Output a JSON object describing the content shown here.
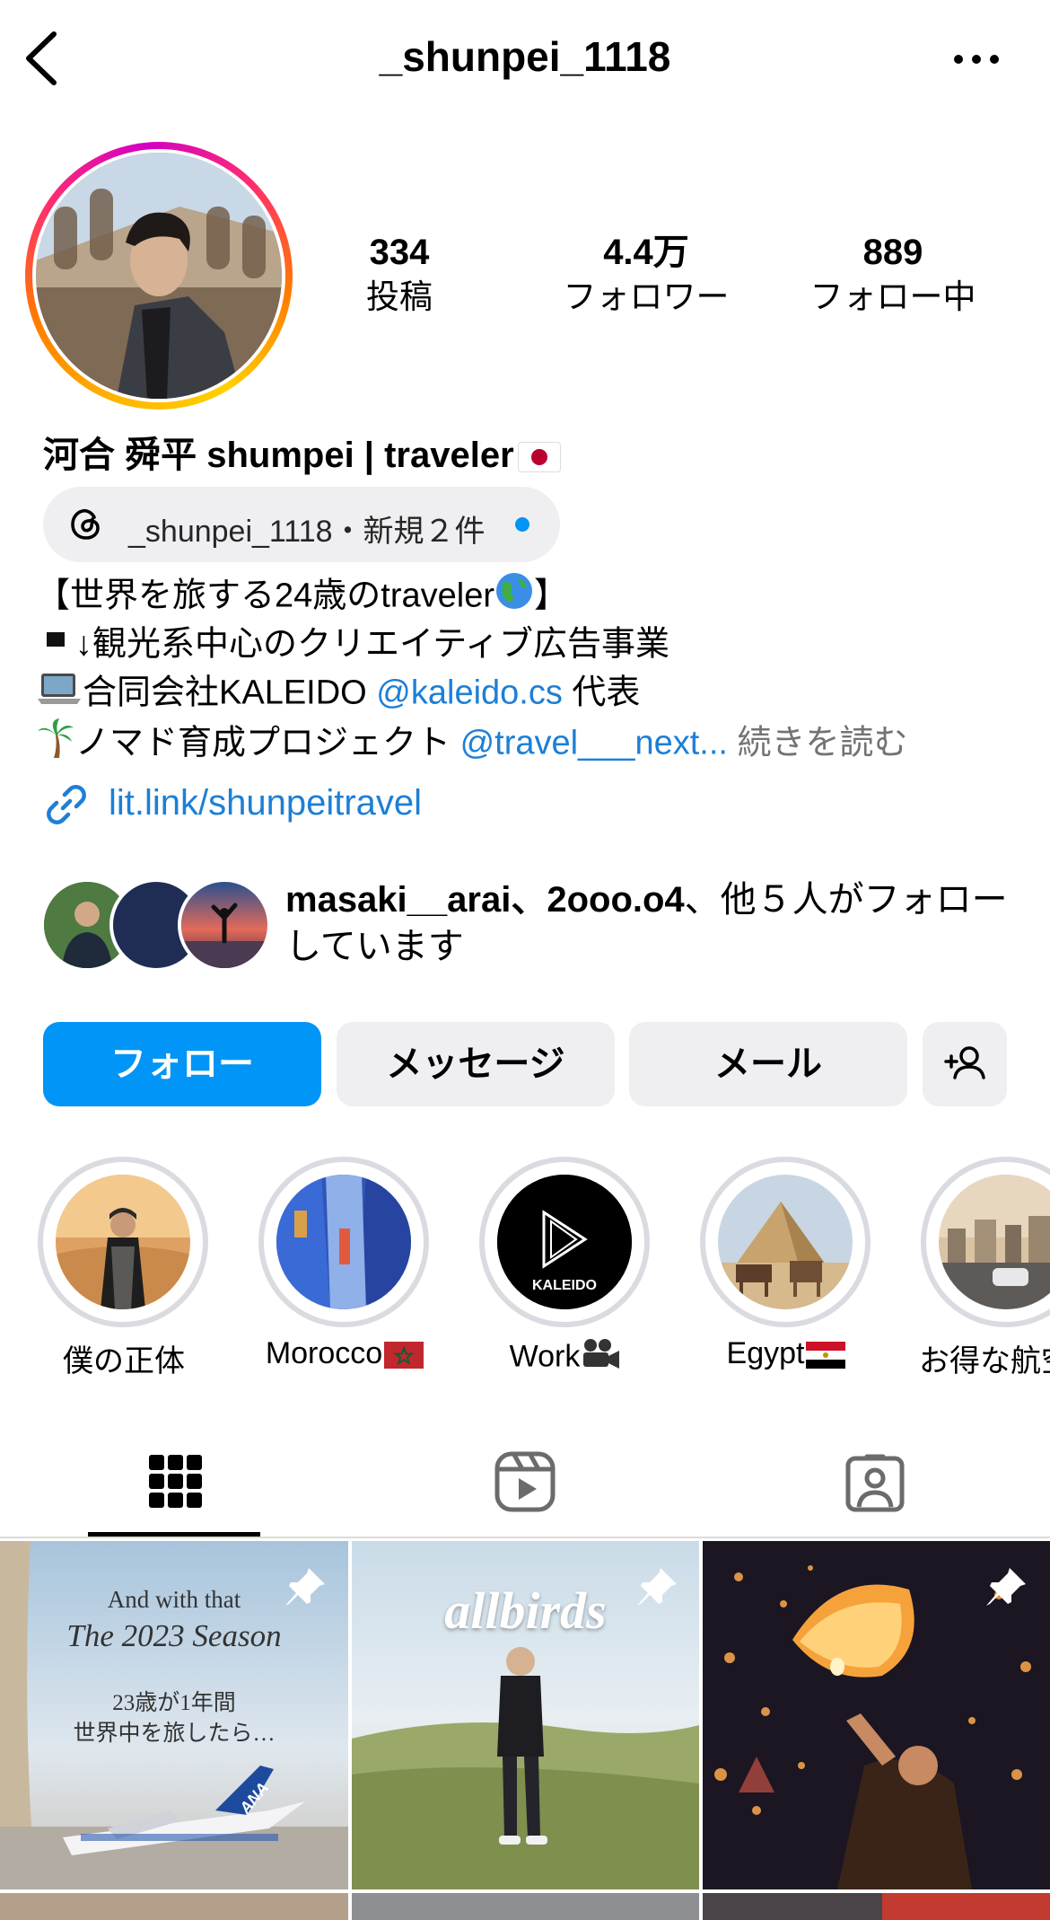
{
  "header": {
    "username": "_shunpei_1118"
  },
  "stats": [
    {
      "value": "334",
      "label": "投稿"
    },
    {
      "value": "4.4万",
      "label": "フォロワー"
    },
    {
      "value": "889",
      "label": "フォロー中"
    }
  ],
  "profile": {
    "display_name": "河合 舜平 shumpei | traveler"
  },
  "threads": {
    "text": "_shunpei_1118・新規２件"
  },
  "bio": {
    "line1_pre": "【世界を旅する24歳のtraveler",
    "line1_post": "】",
    "line2": "↓観光系中心のクリエイティブ広告事業",
    "line3_pre": "合同会社KALEIDO ",
    "line3_link": "@kaleido.cs",
    "line3_post": " 代表",
    "line4_pre": "ノマド育成プロジェクト ",
    "line4_link": "@travel___next...",
    "line4_more": " 続きを読む",
    "url": "lit.link/shunpeitravel"
  },
  "mutual": {
    "names": "masaki__arai、2ooo.o4",
    "rest": "、他５人がフォローしています"
  },
  "buttons": {
    "follow": "フォロー",
    "message": "メッセージ",
    "mail": "メール"
  },
  "highlights": [
    {
      "label": "僕の正体"
    },
    {
      "label": "Morocco"
    },
    {
      "label": "Work"
    },
    {
      "label": "Egypt"
    },
    {
      "label": "お得な航空"
    }
  ],
  "tabs": [
    "grid-icon",
    "reels-icon",
    "tagged-icon"
  ],
  "posts": [
    {
      "line1": "And with that",
      "line2": "The 2023 Season",
      "line3": "23歳が1年間",
      "line4": "世界中を旅したら…",
      "airline": "ANA",
      "pinned": true
    },
    {
      "brand": "allbirds",
      "pinned": true
    },
    {
      "pinned": true
    }
  ],
  "colors": {
    "accent": "#0095f6",
    "link": "#1d7fd6"
  }
}
